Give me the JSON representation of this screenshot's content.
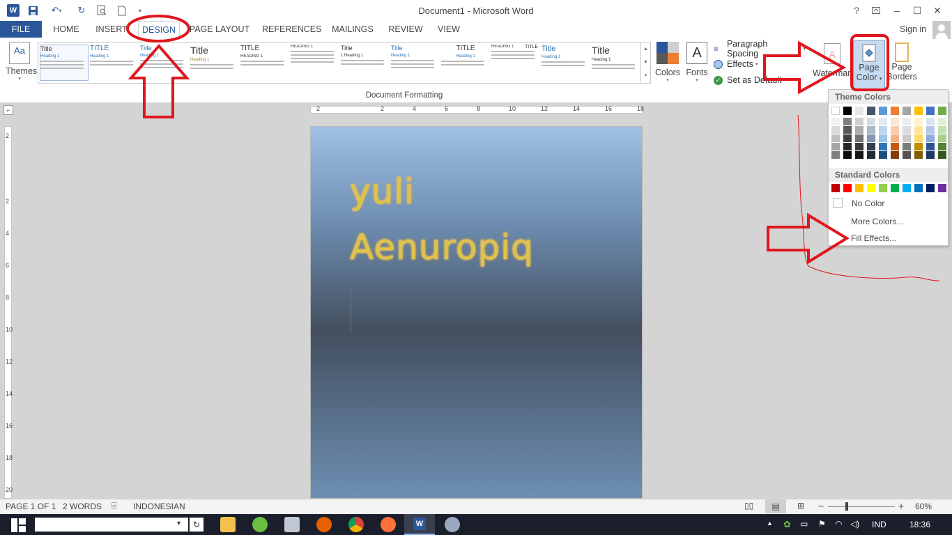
{
  "window": {
    "title": "Document1 - Microsoft Word",
    "help": "?",
    "sign_in": "Sign in"
  },
  "tabs": [
    "FILE",
    "HOME",
    "INSERT",
    "DESIGN",
    "PAGE LAYOUT",
    "REFERENCES",
    "MAILINGS",
    "REVIEW",
    "VIEW"
  ],
  "ribbon": {
    "themes_label": "Themes",
    "style_titles": [
      "Title",
      "TITLE",
      "Title",
      "Title",
      "TITLE",
      "HEADING 1",
      "Title",
      "Title",
      "TITLE",
      "HEADING 1",
      "TITLE",
      "Title",
      "Title"
    ],
    "style_headings": [
      "Heading 1",
      "Heading 1",
      "Heading 1",
      "Heading 1",
      "HEADING 1",
      "",
      "1 Heading 1",
      "Heading 1",
      "Heading 1",
      "",
      "",
      "Heading 1",
      "Heading 1"
    ],
    "group_label": "Document Formatting",
    "colors_label": "Colors",
    "fonts_label": "Fonts",
    "fonts_glyph": "A",
    "paragraph_spacing": "Paragraph Spacing",
    "effects": "Effects",
    "set_default": "Set as Default",
    "watermark": "Watermark",
    "page_color_1": "Page",
    "page_color_2": "Color",
    "page_borders_1": "Page",
    "page_borders_2": "Borders"
  },
  "ruler": {
    "h_marks": [
      "2",
      "2",
      "4",
      "6",
      "8",
      "10",
      "12",
      "14",
      "16",
      "18"
    ],
    "v_marks": [
      "2",
      "2",
      "4",
      "6",
      "8",
      "10",
      "12",
      "14",
      "16",
      "18",
      "20"
    ]
  },
  "document": {
    "line1": "yuli",
    "line2": "Aenuropiq"
  },
  "page_color_menu": {
    "theme_colors_label": "Theme Colors",
    "standard_colors_label": "Standard Colors",
    "no_color": "No Color",
    "more_colors": "More Colors...",
    "fill_effects": "Fill Effects...",
    "theme_colors": [
      [
        "#ffffff",
        "#f2f2f2",
        "#d9d9d9",
        "#bfbfbf",
        "#a6a6a6",
        "#808080"
      ],
      [
        "#000000",
        "#808080",
        "#595959",
        "#404040",
        "#262626",
        "#0d0d0d"
      ],
      [
        "#e7e6e6",
        "#d0cece",
        "#aeabab",
        "#757070",
        "#3b3838",
        "#171616"
      ],
      [
        "#44546a",
        "#d6dce4",
        "#adb9ca",
        "#8496b0",
        "#333f4f",
        "#222a35"
      ],
      [
        "#5b9bd5",
        "#deebf6",
        "#bdd7ee",
        "#9dc3e6",
        "#2e75b5",
        "#1e4e79"
      ],
      [
        "#ed7d31",
        "#fbe5d5",
        "#f7cbac",
        "#f4b183",
        "#c55a11",
        "#843c0b"
      ],
      [
        "#a5a5a5",
        "#ededed",
        "#dbdbdb",
        "#c9c9c9",
        "#7b7b7b",
        "#525252"
      ],
      [
        "#ffc000",
        "#fff2cc",
        "#fee599",
        "#ffd965",
        "#bf9000",
        "#7f6000"
      ],
      [
        "#4472c4",
        "#dae3f3",
        "#b4c7e7",
        "#8faadc",
        "#2f5597",
        "#1f3864"
      ],
      [
        "#70ad47",
        "#e2efd9",
        "#c5e0b3",
        "#a8d08d",
        "#538135",
        "#375623"
      ]
    ],
    "standard_colors": [
      "#c00000",
      "#ff0000",
      "#ffc000",
      "#ffff00",
      "#92d050",
      "#00b050",
      "#00b0f0",
      "#0070c0",
      "#002060",
      "#7030a0"
    ]
  },
  "status": {
    "page": "PAGE 1 OF 1",
    "words": "2 WORDS",
    "language": "INDONESIAN",
    "zoom": "60%",
    "zoom_minus": "−",
    "zoom_plus": "+"
  },
  "taskbar": {
    "lang": "IND",
    "time": "18:36"
  }
}
